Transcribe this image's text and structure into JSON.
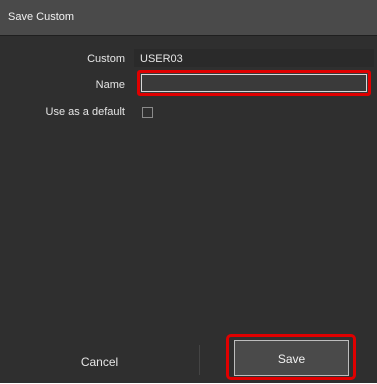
{
  "dialog": {
    "title": "Save Custom",
    "fields": {
      "custom_label": "Custom",
      "custom_value": "USER03",
      "name_label": "Name",
      "name_value": "",
      "default_label": "Use as a default",
      "default_checked": false
    },
    "buttons": {
      "cancel_label": "Cancel",
      "save_label": "Save"
    }
  },
  "colors": {
    "background": "#2f2f2f",
    "title_bar": "#4a4a4a",
    "highlight": "#e00000",
    "text": "#e6e6e6"
  }
}
